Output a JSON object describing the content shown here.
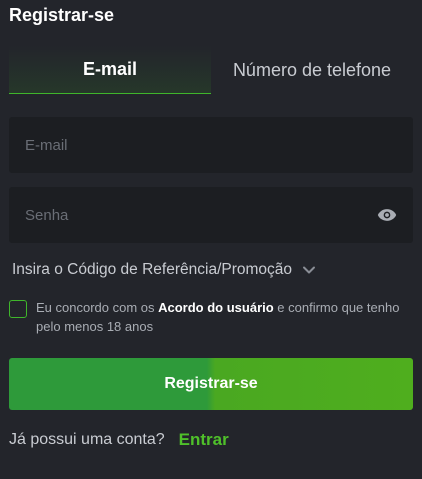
{
  "header": {
    "title": "Registrar-se"
  },
  "tabs": [
    {
      "label": "E-mail",
      "active": true
    },
    {
      "label": "Número de telefone",
      "active": false
    }
  ],
  "form": {
    "email_placeholder": "E-mail",
    "email_value": "",
    "password_placeholder": "Senha",
    "password_value": "",
    "referral_label": "Insira o Código de Referência/Promoção",
    "agree_prefix": "Eu concordo com os ",
    "agree_link": "Acordo do usuário",
    "agree_suffix": " e confirmo que tenho pelo menos 18 anos",
    "agree_checked": false,
    "submit_label": "Registrar-se"
  },
  "footer": {
    "question": "Já possui uma conta?",
    "login_label": "Entrar"
  },
  "icons": {
    "password_toggle": "eye-icon",
    "referral_expand": "chevron-down-icon"
  },
  "colors": {
    "background": "#23252b",
    "field_background": "#1c1e22",
    "accent": "#3fb62b",
    "login_link": "#4fc02a"
  }
}
